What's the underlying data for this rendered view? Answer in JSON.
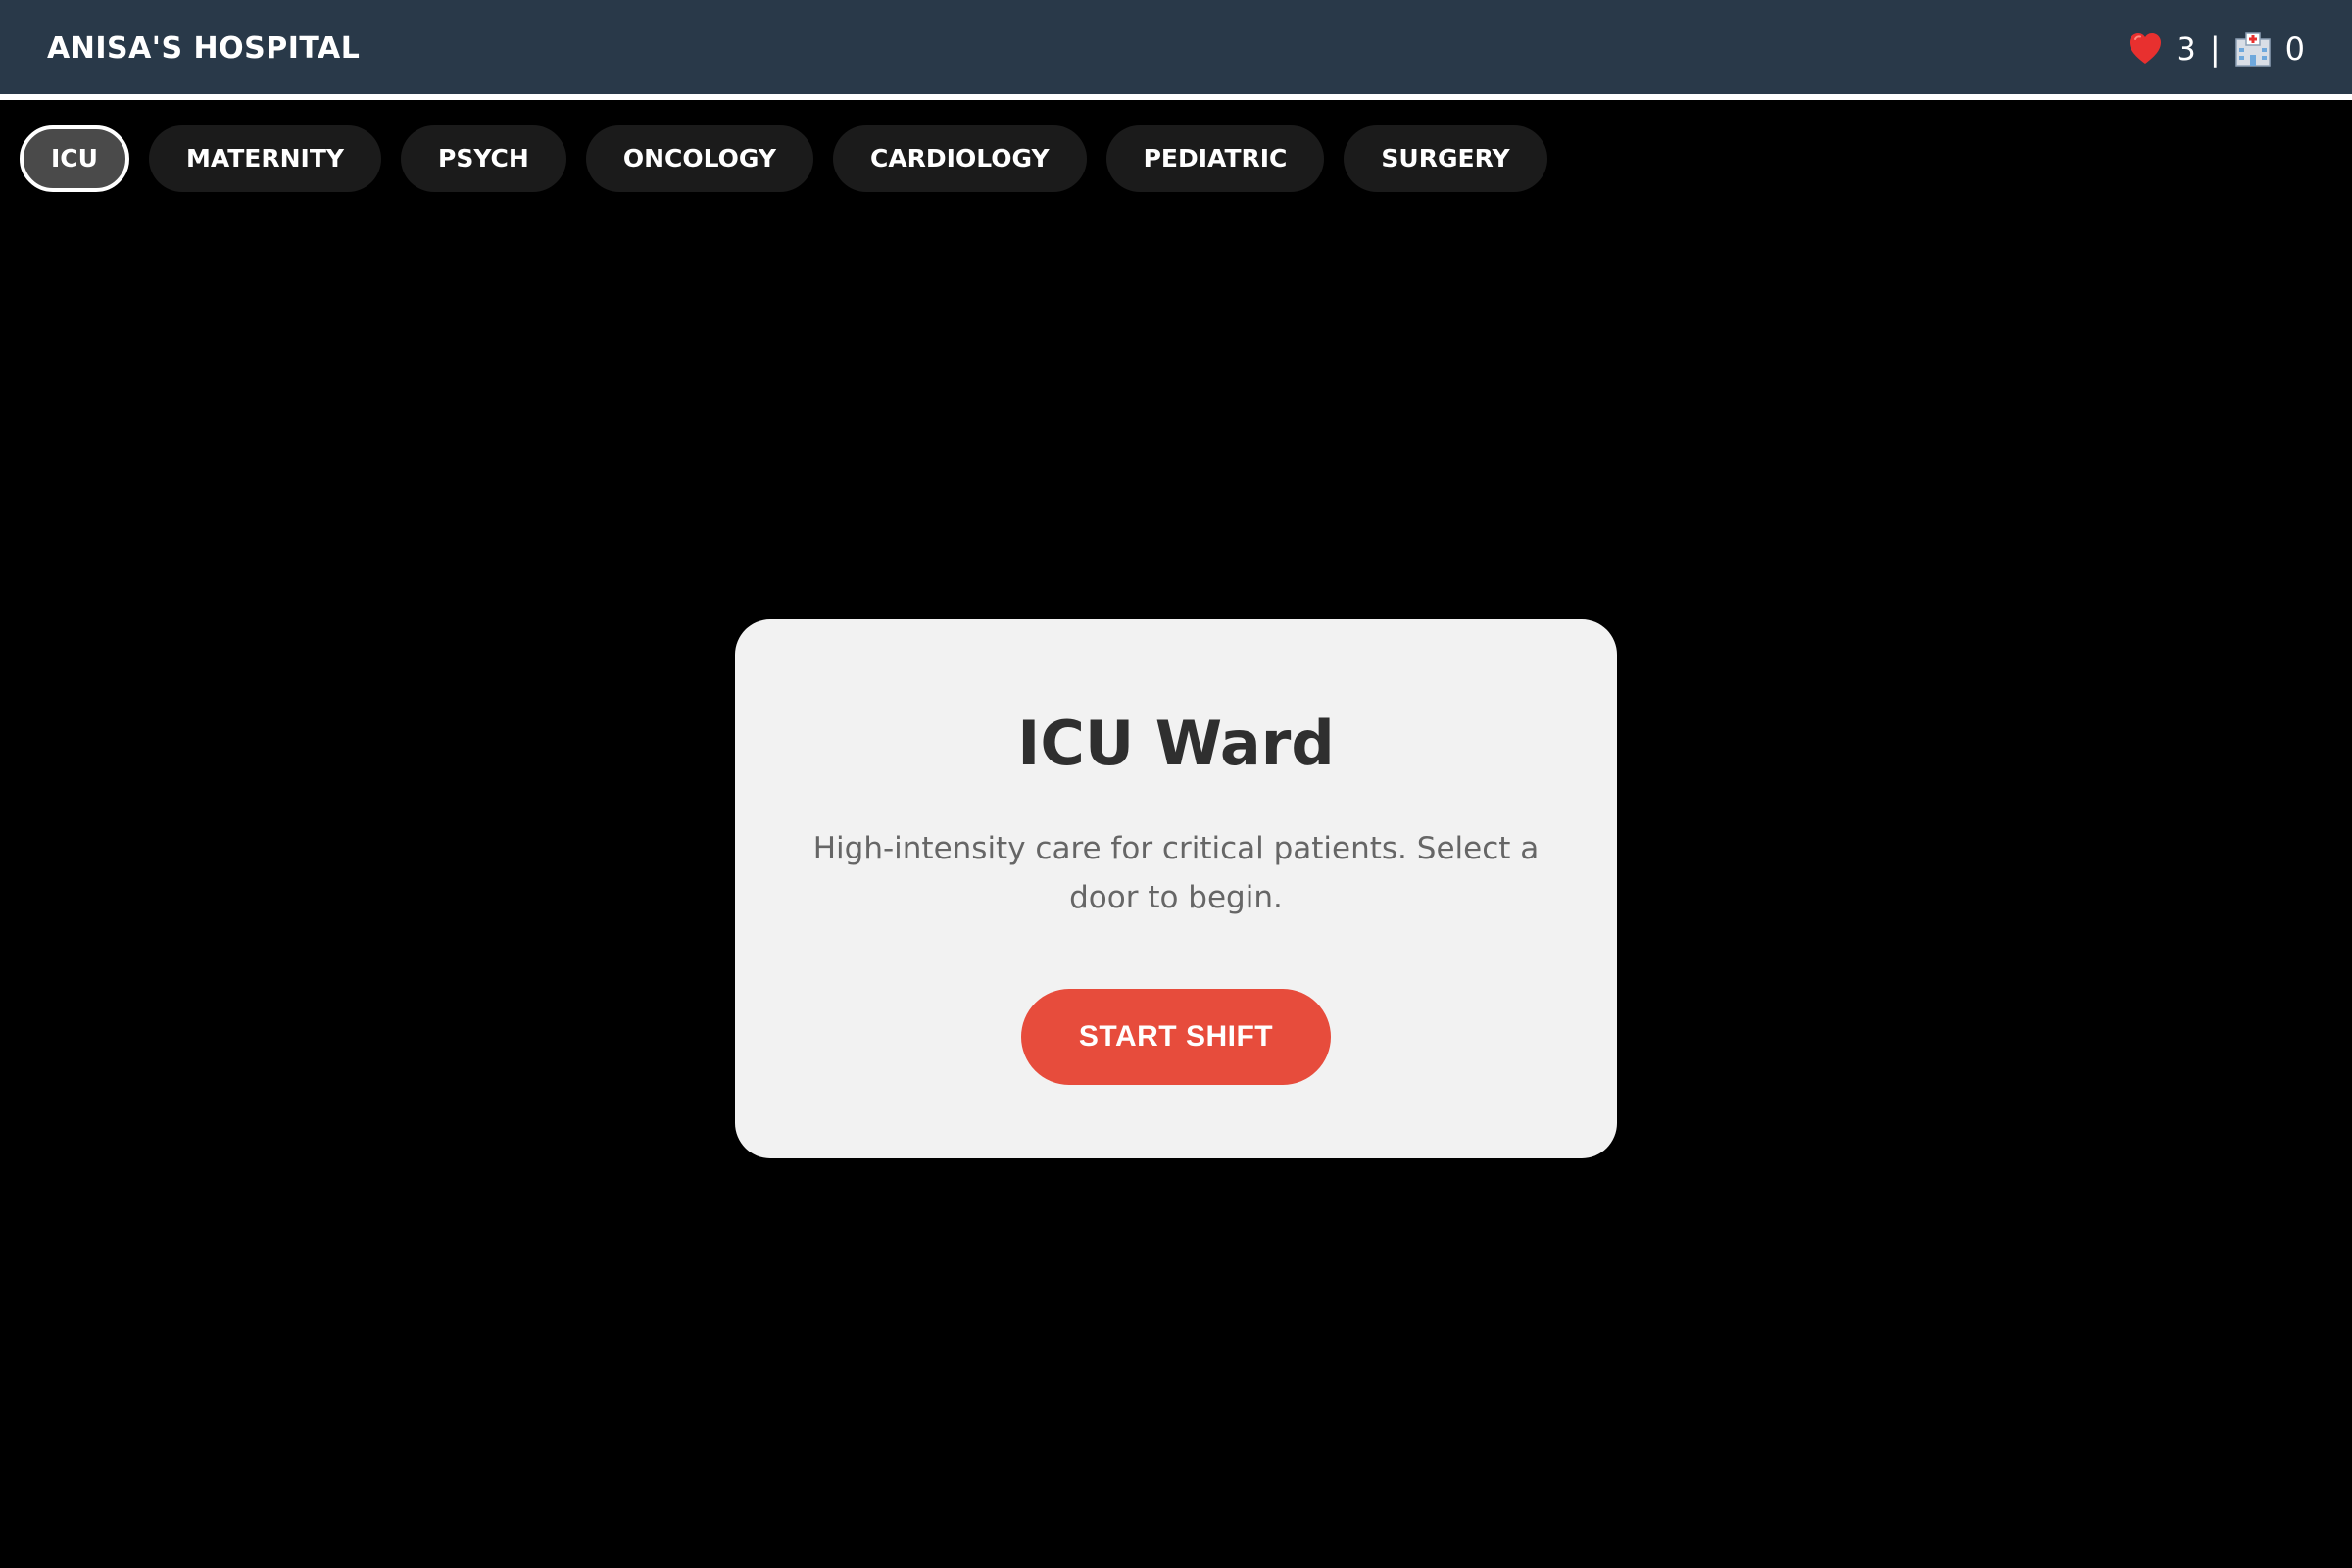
{
  "header": {
    "title": "ANISA'S HOSPITAL",
    "lives": "3",
    "separator": "|",
    "patients": "0",
    "heart_icon": "heart-icon",
    "hospital_icon": "hospital-icon"
  },
  "tabs": [
    {
      "label": "ICU",
      "active": true
    },
    {
      "label": "MATERNITY",
      "active": false
    },
    {
      "label": "PSYCH",
      "active": false
    },
    {
      "label": "ONCOLOGY",
      "active": false
    },
    {
      "label": "CARDIOLOGY",
      "active": false
    },
    {
      "label": "PEDIATRIC",
      "active": false
    },
    {
      "label": "SURGERY",
      "active": false
    }
  ],
  "ward_card": {
    "title": "ICU Ward",
    "description": "High-intensity care for critical patients. Select a door to begin.",
    "button_label": "START SHIFT"
  },
  "colors": {
    "header_bg": "#293949",
    "page_bg": "#000000",
    "card_bg": "#f2f2f2",
    "accent_red": "#e74c3c",
    "tab_bg": "#1b1b1b",
    "tab_active_bg": "#4a4a4a"
  }
}
